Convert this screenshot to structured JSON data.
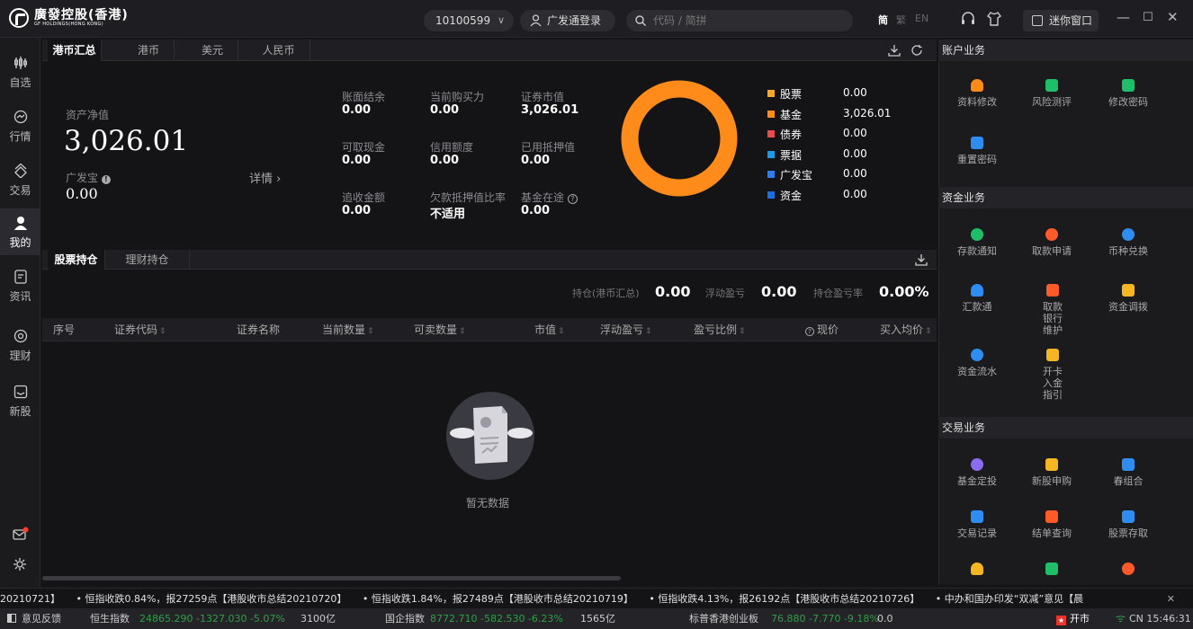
{
  "titlebar": {
    "logo_cn": "廣發控股(香港)",
    "logo_en": "GF HOLDINGS(HONG KONG)",
    "account": "10100599",
    "gf_login": "广发通登录",
    "search_placeholder": "代码 / 简拼",
    "lang_simplified": "简",
    "lang_traditional": "繁",
    "lang_en": "EN",
    "mini_window": "迷你窗口"
  },
  "sidebar": {
    "items": [
      {
        "label": "自选",
        "icon": "watchlist-icon"
      },
      {
        "label": "行情",
        "icon": "market-icon"
      },
      {
        "label": "交易",
        "icon": "trade-icon"
      },
      {
        "label": "我的",
        "icon": "user-icon"
      },
      {
        "label": "资讯",
        "icon": "news-icon"
      },
      {
        "label": "理财",
        "icon": "wealth-icon"
      },
      {
        "label": "新股",
        "icon": "ipo-icon"
      }
    ]
  },
  "currency_tabs": [
    "港币汇总",
    "港币",
    "美元",
    "人民币"
  ],
  "summary": {
    "net_asset_label": "资产净值",
    "net_asset": "3,026.01",
    "gfb_label": "广发宝",
    "gfb_value": "0.00",
    "detail": "详情 ›",
    "fields": [
      {
        "label": "账面结余",
        "value": "0.00"
      },
      {
        "label": "当前购买力",
        "value": "0.00"
      },
      {
        "label": "证券市值",
        "value": "3,026.01"
      },
      {
        "label": "可取现金",
        "value": "0.00"
      },
      {
        "label": "信用额度",
        "value": "0.00"
      },
      {
        "label": "已用抵押值",
        "value": "0.00"
      },
      {
        "label": "追收金额",
        "value": "0.00"
      },
      {
        "label": "欠款抵押值比率",
        "value": "不适用"
      },
      {
        "label": "基金在途",
        "value": "0.00"
      }
    ]
  },
  "chart_data": {
    "type": "pie",
    "categories": [
      "股票",
      "基金",
      "债券",
      "票据",
      "广发宝",
      "资金"
    ],
    "values": [
      0.0,
      3026.01,
      0.0,
      0.0,
      0.0,
      0.0
    ],
    "labels": [
      "0.00",
      "3,026.01",
      "0.00",
      "0.00",
      "0.00",
      "0.00"
    ],
    "colors": [
      "#f5a623",
      "#ff8c1a",
      "#e84c4c",
      "#1e9be8",
      "#2d7cf0",
      "#1a6ee0"
    ],
    "donut": true
  },
  "holdings": {
    "tabs": [
      "股票持仓",
      "理财持仓"
    ],
    "stats": [
      {
        "label": "持仓(港币汇总)",
        "value": "0.00"
      },
      {
        "label": "浮动盈亏",
        "value": "0.00"
      },
      {
        "label": "持仓盈亏率",
        "value": "0.00%"
      }
    ],
    "columns": [
      "序号",
      "证券代码",
      "证券名称",
      "当前数量",
      "可卖数量",
      "市值",
      "浮动盈亏",
      "盈亏比例",
      "现价",
      "买入均价"
    ],
    "empty_text": "暂无数据"
  },
  "right_panel": {
    "account_title": "账户业务",
    "account_items": [
      "资料修改",
      "风险测评",
      "修改密码",
      "重置密码"
    ],
    "fund_title": "资金业务",
    "fund_items": [
      "存款通知",
      "取款申请",
      "币种兑换",
      "汇款通",
      "取款银行维护",
      "资金调拨",
      "资金流水",
      "开卡入金指引"
    ],
    "trade_title": "交易业务",
    "trade_items": [
      "基金定投",
      "新股申购",
      "春组合",
      "交易记录",
      "结单查询",
      "股票存取"
    ],
    "colors": {
      "orange": "#ff8c1a",
      "green": "#1fbf6a",
      "blue": "#2f8cf0",
      "red": "#ff5a2a",
      "purple": "#8b6cf0",
      "yellow": "#f5b623"
    }
  },
  "ticker": {
    "items": [
      "20210721】",
      "• 恒指收跌0.84%，报27259点【港股收市总结20210720】",
      "• 恒指收跌1.84%，报27489点【港股收市总结20210719】",
      "• 恒指收跌4.13%，报26192点【港股收市总结20210726】",
      "• 中办和国办印发“双减”意见【晨"
    ]
  },
  "status": {
    "feedback": "意见反馈",
    "hsi": "恒生指数",
    "hsi_vals": "24865.290 -1327.030 -5.07%",
    "hsi_vol": "3100亿",
    "hscei": "国企指数",
    "hscei_vals": "8772.710 -582.530 -6.23%",
    "hscei_vol": "1565亿",
    "gem": "标普香港创业板",
    "gem_vals": "76.880 -7.770 -9.18%",
    "gem_vol": "0.0",
    "market": "开市",
    "time": "CN 15:46:31"
  }
}
